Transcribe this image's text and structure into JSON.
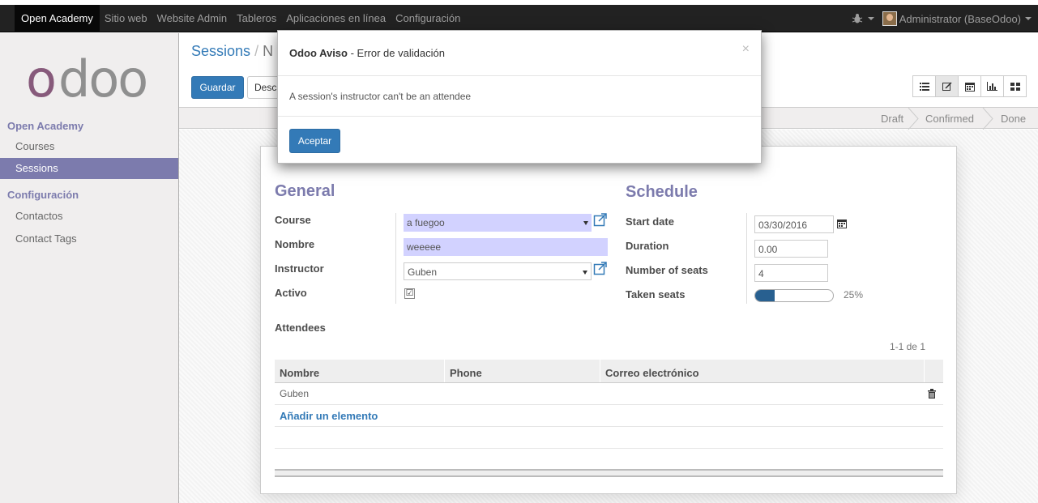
{
  "topbar": {
    "menu": [
      "Open Academy",
      "Sitio web",
      "Website Admin",
      "Tableros",
      "Aplicaciones en línea",
      "Configuración"
    ],
    "user": "Administrator (BaseOdoo)"
  },
  "sidebar": {
    "logo": "odoo",
    "section1": "Open Academy",
    "items1": [
      "Courses",
      "Sessions"
    ],
    "section2": "Configuración",
    "items2": [
      "Contactos",
      "Contact Tags"
    ]
  },
  "header": {
    "breadcrumb_root": "Sessions",
    "breadcrumb_sep": "/",
    "breadcrumb_current": "N",
    "save_label": "Guardar",
    "discard_label": "Desc"
  },
  "statusbar": [
    "Draft",
    "Confirmed",
    "Done"
  ],
  "form": {
    "general_title": "General",
    "schedule_title": "Schedule",
    "course_label": "Course",
    "course_value": "a fuegoo",
    "name_label": "Nombre",
    "name_value": "weeeee",
    "instructor_label": "Instructor",
    "instructor_value": "Guben",
    "active_label": "Activo",
    "active_checked": "☑",
    "start_label": "Start date",
    "start_value": "03/30/2016",
    "duration_label": "Duration",
    "duration_value": "0.00",
    "seats_label": "Number of seats",
    "seats_value": "4",
    "taken_label": "Taken seats",
    "taken_value": "25%",
    "taken_fraction": 0.25
  },
  "attendees": {
    "title": "Attendees",
    "pager": "1-1 de 1",
    "columns": [
      "Nombre",
      "Phone",
      "Correo electrónico"
    ],
    "rows": [
      [
        "Guben",
        "",
        ""
      ]
    ],
    "add_label": "Añadir un elemento"
  },
  "modal": {
    "title_strong": "Odoo Aviso",
    "title_rest": " - Error de validación",
    "close": "×",
    "message": "A session's instructor can't be an attendee",
    "ok_label": "Aceptar"
  },
  "colors": {
    "accent": "#7c7bad",
    "primary": "#337ab7",
    "topbar": "#222222"
  }
}
